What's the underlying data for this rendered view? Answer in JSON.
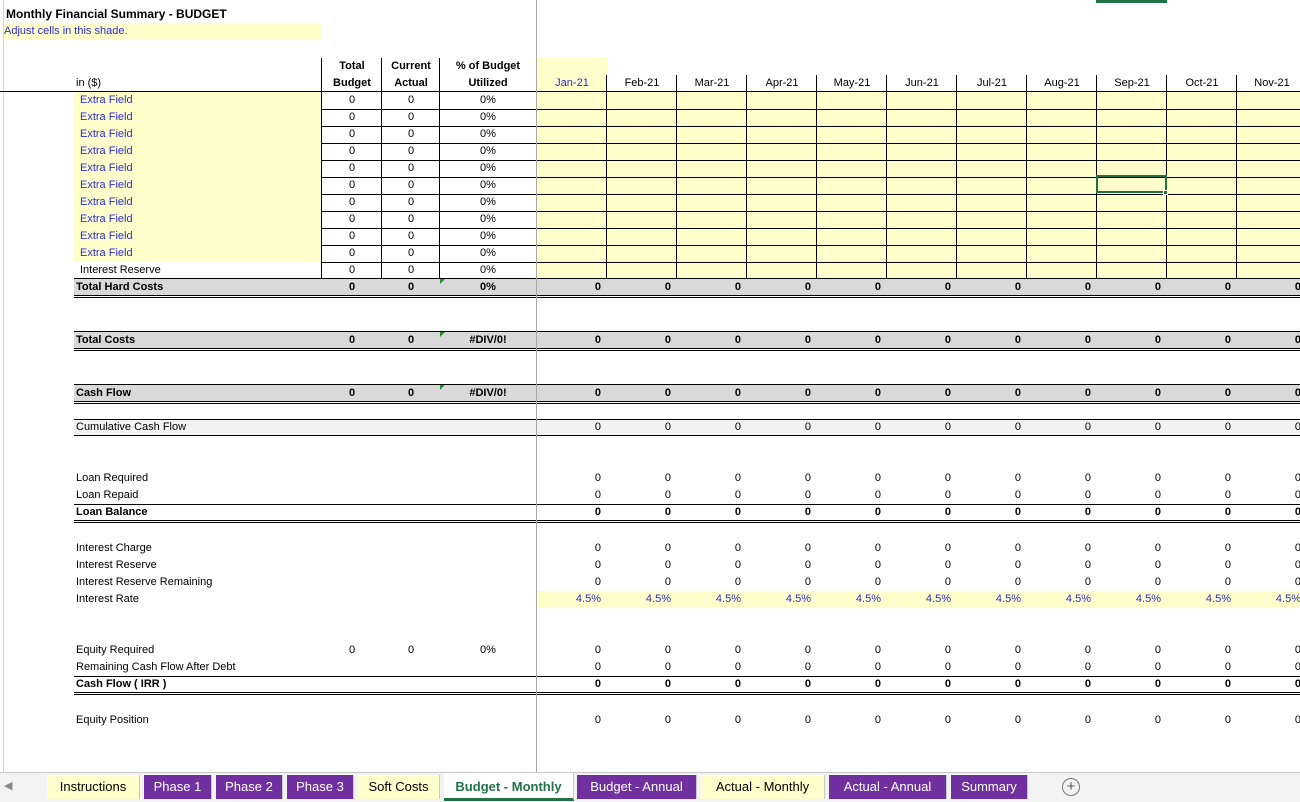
{
  "sheet": {
    "title": "Monthly Financial Summary - BUDGET",
    "subtitle": "Adjust cells in this shade.",
    "units_label": "in ($)",
    "col_headers": {
      "total_budget_1": "Total",
      "total_budget_2": "Budget",
      "current_actual_1": "Current",
      "current_actual_2": "Actual",
      "pct_1": "% of Budget",
      "pct_2": "Utilized"
    },
    "months": [
      "Jan-21",
      "Feb-21",
      "Mar-21",
      "Apr-21",
      "May-21",
      "Jun-21",
      "Jul-21",
      "Aug-21",
      "Sep-21",
      "Oct-21",
      "Nov-21"
    ],
    "extra_rows": [
      {
        "label": "Extra Field",
        "budget": "0",
        "actual": "0",
        "pct": "0%"
      },
      {
        "label": "Extra Field",
        "budget": "0",
        "actual": "0",
        "pct": "0%"
      },
      {
        "label": "Extra Field",
        "budget": "0",
        "actual": "0",
        "pct": "0%"
      },
      {
        "label": "Extra Field",
        "budget": "0",
        "actual": "0",
        "pct": "0%"
      },
      {
        "label": "Extra Field",
        "budget": "0",
        "actual": "0",
        "pct": "0%"
      },
      {
        "label": "Extra Field",
        "budget": "0",
        "actual": "0",
        "pct": "0%"
      },
      {
        "label": "Extra Field",
        "budget": "0",
        "actual": "0",
        "pct": "0%"
      },
      {
        "label": "Extra Field",
        "budget": "0",
        "actual": "0",
        "pct": "0%"
      },
      {
        "label": "Extra Field",
        "budget": "0",
        "actual": "0",
        "pct": "0%"
      },
      {
        "label": "Extra Field",
        "budget": "0",
        "actual": "0",
        "pct": "0%"
      }
    ],
    "interest_reserve_row": {
      "label": "Interest Reserve",
      "budget": "0",
      "actual": "0",
      "pct": "0%"
    },
    "total_hard_costs": {
      "label": "Total Hard Costs",
      "budget": "0",
      "actual": "0",
      "pct": "0%",
      "month_value": "0"
    },
    "total_costs": {
      "label": "Total Costs",
      "budget": "0",
      "actual": "0",
      "pct": "#DIV/0!",
      "month_value": "0"
    },
    "cash_flow": {
      "label": "Cash Flow",
      "budget": "0",
      "actual": "0",
      "pct": "#DIV/0!",
      "month_value": "0"
    },
    "cumulative_cash_flow": {
      "label": "Cumulative Cash Flow",
      "month_value": "0"
    },
    "loan_required": {
      "label": "Loan Required",
      "month_value": "0"
    },
    "loan_repaid": {
      "label": "Loan Repaid",
      "month_value": "0"
    },
    "loan_balance": {
      "label": "Loan Balance",
      "month_value": "0"
    },
    "interest_charge": {
      "label": "Interest Charge",
      "month_value": "0"
    },
    "interest_reserve": {
      "label": "Interest Reserve",
      "month_value": "0"
    },
    "interest_reserve_remaining": {
      "label": "Interest Reserve Remaining",
      "month_value": "0"
    },
    "interest_rate": {
      "label": "Interest Rate",
      "month_value": "4.5%"
    },
    "equity_required": {
      "label": "Equity Required",
      "budget": "0",
      "actual": "0",
      "pct": "0%",
      "month_value": "0"
    },
    "remaining_cash_flow": {
      "label": "Remaining Cash Flow After Debt",
      "month_value": "0"
    },
    "cash_flow_irr": {
      "label": "Cash Flow ( IRR )",
      "month_value": "0"
    },
    "equity_position": {
      "label": "Equity Position",
      "month_value": "0"
    }
  },
  "tabs": [
    {
      "label": "Instructions",
      "style": "yellow"
    },
    {
      "label": "Phase 1",
      "style": "purple"
    },
    {
      "label": "Phase 2",
      "style": "purple"
    },
    {
      "label": "Phase 3",
      "style": "purple"
    },
    {
      "label": "Soft Costs",
      "style": "yellow"
    },
    {
      "label": "Budget - Monthly",
      "style": "active"
    },
    {
      "label": "Budget - Annual",
      "style": "purple"
    },
    {
      "label": "Actual - Monthly",
      "style": "yellow"
    },
    {
      "label": "Actual - Annual",
      "style": "purple"
    },
    {
      "label": "Summary",
      "style": "purple"
    }
  ],
  "colors": {
    "input_shade": "#ffffcc",
    "tab_purple": "#7030a0",
    "active_green": "#217346",
    "input_text_blue": "#2b2bd8"
  }
}
